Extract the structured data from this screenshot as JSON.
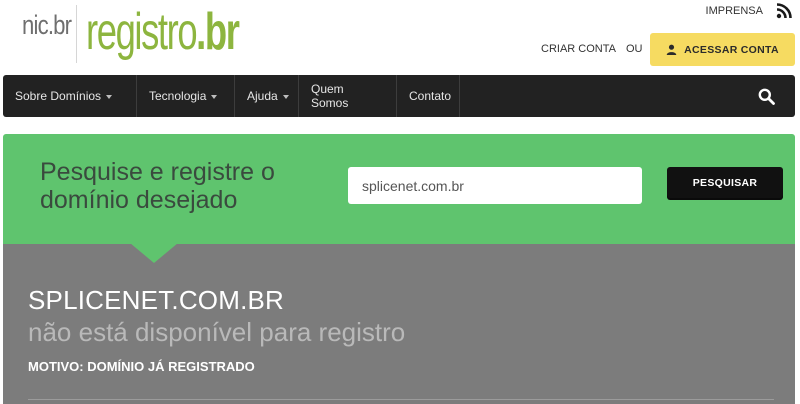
{
  "header": {
    "logo_nic": "nic.br",
    "logo_registro": "registro",
    "logo_br": ".br",
    "imprensa": "IMPRENSA",
    "criar_conta": "CRIAR CONTA",
    "ou": "OU",
    "acessar_conta": "ACESSAR CONTA",
    "icons": {
      "rss": "rss-icon",
      "user": "user-icon"
    }
  },
  "nav": {
    "items": [
      {
        "label": "Sobre Domínios",
        "has_dropdown": true
      },
      {
        "label": "Tecnologia",
        "has_dropdown": true
      },
      {
        "label": "Ajuda",
        "has_dropdown": true
      },
      {
        "label": "Quem Somos",
        "has_dropdown": false
      },
      {
        "label": "Contato",
        "has_dropdown": false
      }
    ],
    "search_icon": "search-icon"
  },
  "search": {
    "title": "Pesquise e registre o domínio desejado",
    "input_value": "splicenet.com.br",
    "button_label": "PESQUISAR"
  },
  "result": {
    "domain": "SPLICENET.COM.BR",
    "status": "não está disponível para registro",
    "reason": "MOTIVO: DOMÍNIO JÁ REGISTRADO"
  },
  "colors": {
    "brand_green": "#8db53f",
    "search_panel": "#5fc46e",
    "result_panel": "#7c7c7c",
    "nav_bg": "#222222",
    "cta_yellow": "#f6db61"
  }
}
